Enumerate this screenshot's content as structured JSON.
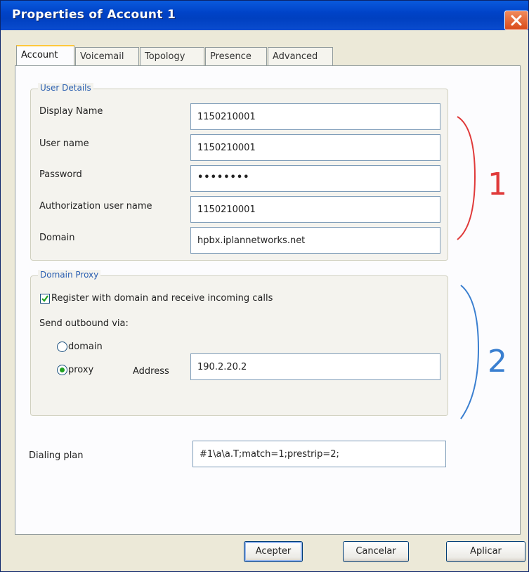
{
  "window": {
    "title": "Properties of Account 1"
  },
  "tabs": [
    {
      "label": "Account",
      "active": true
    },
    {
      "label": "Voicemail",
      "active": false
    },
    {
      "label": "Topology",
      "active": false
    },
    {
      "label": "Presence",
      "active": false
    },
    {
      "label": "Advanced",
      "active": false
    }
  ],
  "user_details": {
    "title": "User Details",
    "display_name": {
      "label": "Display Name",
      "value": "1150210001"
    },
    "user_name": {
      "label": "User name",
      "value": "1150210001"
    },
    "password": {
      "label": "Password",
      "value": "••••••••"
    },
    "auth_user_name": {
      "label": "Authorization user name",
      "value": "1150210001"
    },
    "domain": {
      "label": "Domain",
      "value": "hpbx.iplannetworks.net"
    }
  },
  "domain_proxy": {
    "title": "Domain Proxy",
    "register_label": "Register with domain and receive incoming calls",
    "register_checked": true,
    "send_outbound_label": "Send outbound via:",
    "option_domain": "domain",
    "option_proxy": "proxy",
    "selected_option": "proxy",
    "address_label": "Address",
    "address_value": "190.2.20.2"
  },
  "dialing_plan": {
    "label": "Dialing plan",
    "value": "#1\\a\\a.T;match=1;prestrip=2;"
  },
  "buttons": {
    "accept": "Acepter",
    "cancel": "Cancelar",
    "apply": "Aplicar"
  },
  "annotations": [
    {
      "label": "1",
      "color": "#e03a3a"
    },
    {
      "label": "2",
      "color": "#3a7fd0"
    }
  ]
}
